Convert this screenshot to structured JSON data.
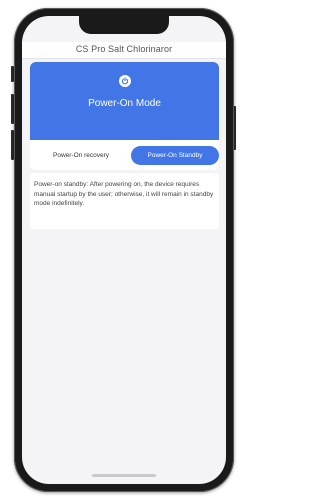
{
  "app": {
    "title": "CS Pro Salt Chlorinaror"
  },
  "hero": {
    "icon": "power-icon",
    "title": "Power-On Mode"
  },
  "mode_selector": {
    "options": [
      "Power-On recovery",
      "Power-On Standby"
    ],
    "selected": "Power-On Standby"
  },
  "description": "Power-on standby: After powering on, the device requires manual startup by the user; otherwise, it will remain in standby mode indefinitely.",
  "colors": {
    "accent": "#4276e6",
    "background": "#f4f4f6",
    "card": "#ffffff",
    "text": "#444444"
  }
}
